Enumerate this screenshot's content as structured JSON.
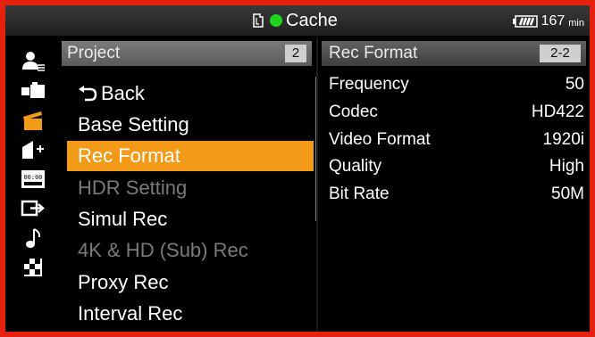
{
  "status": {
    "media_label": "Cache",
    "remaining": "167",
    "remaining_unit": "min"
  },
  "menu": {
    "title": "Project",
    "page": "2",
    "items": [
      {
        "label": "Back"
      },
      {
        "label": "Base Setting"
      },
      {
        "label": "Rec Format"
      },
      {
        "label": "HDR Setting"
      },
      {
        "label": "Simul Rec"
      },
      {
        "label": "4K & HD (Sub) Rec"
      },
      {
        "label": "Proxy Rec"
      },
      {
        "label": "Interval Rec"
      }
    ],
    "selected_index": 2,
    "disabled": [
      "HDR Setting",
      "4K & HD (Sub) Rec"
    ]
  },
  "detail": {
    "title": "Rec Format",
    "page": "2-2",
    "rows": [
      {
        "label": "Frequency",
        "value": "50"
      },
      {
        "label": "Codec",
        "value": "HD422"
      },
      {
        "label": "Video Format",
        "value": "1920i"
      },
      {
        "label": "Quality",
        "value": "High"
      },
      {
        "label": "Bit Rate",
        "value": "50M"
      }
    ]
  },
  "side_icons": [
    "user-icon",
    "camera-icon",
    "clapper-icon",
    "paint-icon",
    "timecode-icon",
    "output-icon",
    "audio-icon",
    "grid-icon"
  ],
  "colors": {
    "selected": "#f39a18",
    "frame": "#e4210e",
    "rec_dot": "#1ed41e"
  }
}
